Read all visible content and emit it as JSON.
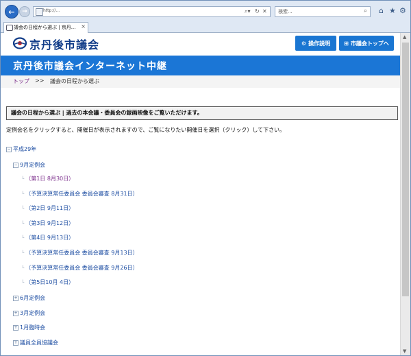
{
  "browser": {
    "url_text": "http://...",
    "search_placeholder": "検索...",
    "tab_title": "議会の日程から選ぶ | 京丹...",
    "back_glyph": "←",
    "fwd_glyph": "→"
  },
  "site": {
    "logo_text": "京丹後市議会",
    "help_button": "操作説明",
    "council_top_button": "市議会トップへ",
    "banner_title": "京丹後市議会インターネット中継"
  },
  "breadcrumb": {
    "home": "トップ",
    "separator": ">>",
    "current": "議会の日程から選ぶ"
  },
  "notice": "議会の日程から選ぶ | 過去の本会議・委員会の録画映像をご覧いただけます。",
  "intro": "定例会名をクリックすると、開催日が表示されますので、ご覧になりたい開催日を選択（クリック）して下さい。",
  "tree": {
    "year": "平成29年",
    "session_open": "9月定例会",
    "days": [
      "（第1日 8月30日）",
      "（予算決算常任委員会 委員会審査 8月31日）",
      "（第2日 9月11日）",
      "（第3日 9月12日）",
      "（第4日 9月13日）",
      "（予算決算常任委員会 委員会審査 9月13日）",
      "（予算決算常任委員会 委員会審査 9月26日）",
      "（第5日10月 4日）"
    ],
    "other_sessions": [
      "6月定例会",
      "3月定例会",
      "1月臨時会",
      "議員全員協議会"
    ]
  },
  "colors": {
    "banner": "#1b76d6",
    "link": "#1f4fa3",
    "visited": "#7b2d8b"
  }
}
